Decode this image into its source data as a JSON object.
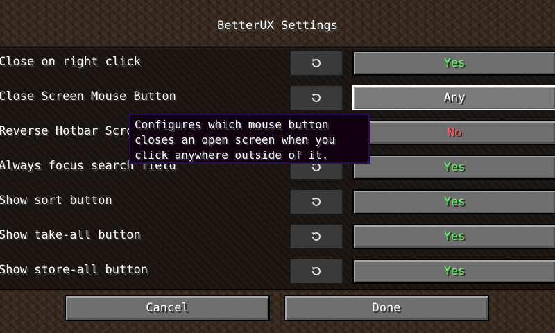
{
  "screen": {
    "title": "BetterUX Settings"
  },
  "rows": [
    {
      "label": "Close on right click",
      "value": "Yes",
      "state": "yes"
    },
    {
      "label": "Close Screen Mouse Button",
      "value": "Any",
      "state": "any"
    },
    {
      "label": "Reverse Hotbar Scroll",
      "value": "No",
      "state": "no"
    },
    {
      "label": "Always focus search field",
      "value": "Yes",
      "state": "yes"
    },
    {
      "label": "Show sort button",
      "value": "Yes",
      "state": "yes"
    },
    {
      "label": "Show take-all button",
      "value": "Yes",
      "state": "yes"
    },
    {
      "label": "Show store-all button",
      "value": "Yes",
      "state": "yes"
    }
  ],
  "reset_icon": "reset-icon",
  "tooltip": {
    "lines": [
      "Configures which mouse button",
      "closes an open screen when you",
      "click anywhere outside of it."
    ]
  },
  "footer": {
    "cancel_label": "Cancel",
    "done_label": "Done"
  },
  "colors": {
    "yes": "#55ff55",
    "no": "#ff5555",
    "tooltip_border": "#2c0a63",
    "tooltip_bg": "#100010"
  }
}
